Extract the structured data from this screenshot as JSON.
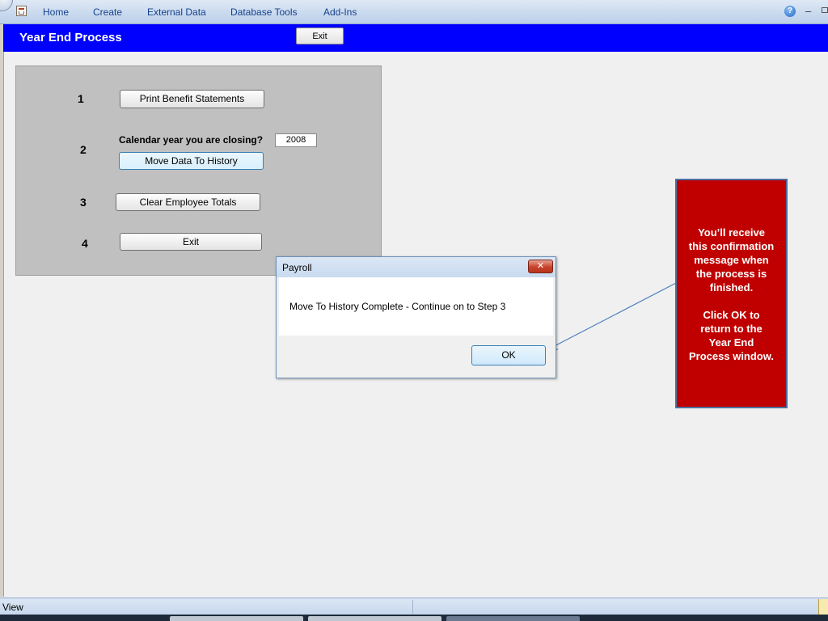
{
  "ribbon": {
    "tabs": [
      "Home",
      "Create",
      "External Data",
      "Database Tools",
      "Add-Ins"
    ],
    "help_symbol": "?",
    "minimize_symbol": "–"
  },
  "form": {
    "title": "Year End Process",
    "exit_label": "Exit"
  },
  "steps": {
    "step1": {
      "number": "1",
      "button": "Print Benefit Statements"
    },
    "step2": {
      "number": "2",
      "question": "Calendar year you are closing?",
      "year_value": "2008",
      "button": "Move Data To History"
    },
    "step3": {
      "number": "3",
      "button": "Clear Employee Totals"
    },
    "step4": {
      "number": "4",
      "button": "Exit"
    }
  },
  "dialog": {
    "title": "Payroll",
    "close_symbol": "✕",
    "message": "Move To History Complete - Continue on to Step 3",
    "ok_label": "OK"
  },
  "callout": {
    "lines1": [
      "You’ll receive",
      "this confirmation",
      "message when",
      "the process is",
      "finished."
    ],
    "lines2": [
      "Click OK to",
      "return to the",
      "Year End",
      "Process window."
    ],
    "background": "#c00000"
  },
  "status": {
    "text": "View"
  },
  "colors": {
    "header_blue": "#0000ff",
    "panel_grey": "#c0c0c0"
  }
}
